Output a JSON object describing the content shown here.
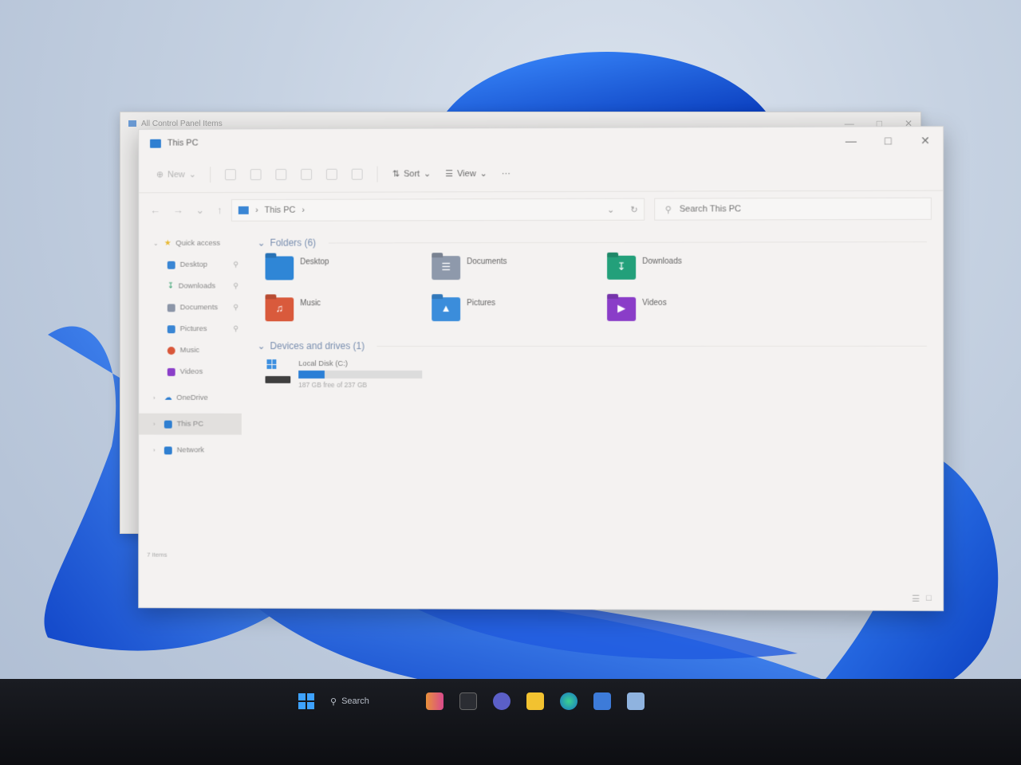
{
  "background_window": {
    "title": "All Control Panel Items"
  },
  "explorer": {
    "title": "This PC",
    "toolbar": {
      "new_label": "New",
      "sort_label": "Sort",
      "view_label": "View",
      "more_label": "···"
    },
    "address": {
      "path": "This PC"
    },
    "search": {
      "placeholder": "Search This PC"
    },
    "sidebar": {
      "items": [
        {
          "label": "Quick access",
          "icon": "star-icon",
          "color": "#e8b932"
        },
        {
          "label": "Desktop",
          "icon": "desktop-folder-icon",
          "color": "#3a86d4",
          "pinned": true
        },
        {
          "label": "Downloads",
          "icon": "download-icon",
          "color": "#2e9e6a",
          "pinned": true
        },
        {
          "label": "Documents",
          "icon": "documents-icon",
          "color": "#8c96a8",
          "pinned": true
        },
        {
          "label": "Pictures",
          "icon": "pictures-icon",
          "color": "#3a86d4",
          "pinned": true
        },
        {
          "label": "Music",
          "icon": "music-icon",
          "color": "#d9573a"
        },
        {
          "label": "Videos",
          "icon": "videos-icon",
          "color": "#8b3fc9"
        },
        {
          "label": "OneDrive",
          "icon": "cloud-icon",
          "color": "#2f7fd1"
        },
        {
          "label": "This PC",
          "icon": "pc-icon",
          "color": "#2f7fd1"
        },
        {
          "label": "Network",
          "icon": "network-icon",
          "color": "#2f7fd1"
        }
      ]
    },
    "folders_header": "Folders (6)",
    "folders": [
      {
        "label": "Desktop",
        "icon": "desktop-folder-icon",
        "color": "#2f86d6"
      },
      {
        "label": "Documents",
        "icon": "documents-folder-icon",
        "color": "#8e99ab"
      },
      {
        "label": "Downloads",
        "icon": "downloads-folder-icon",
        "color": "#23a07a"
      },
      {
        "label": "Music",
        "icon": "music-folder-icon",
        "color": "#d95a3c"
      },
      {
        "label": "Pictures",
        "icon": "pictures-folder-icon",
        "color": "#3b8ddb"
      },
      {
        "label": "Videos",
        "icon": "videos-folder-icon",
        "color": "#8a3dc8"
      }
    ],
    "drives_header": "Devices and drives (1)",
    "drive": {
      "label": "Local Disk (C:)",
      "free_text": "187 GB free of 237 GB",
      "used_fraction": 0.21
    },
    "status": "7 items"
  },
  "taskbar": {
    "search_label": "Search"
  }
}
